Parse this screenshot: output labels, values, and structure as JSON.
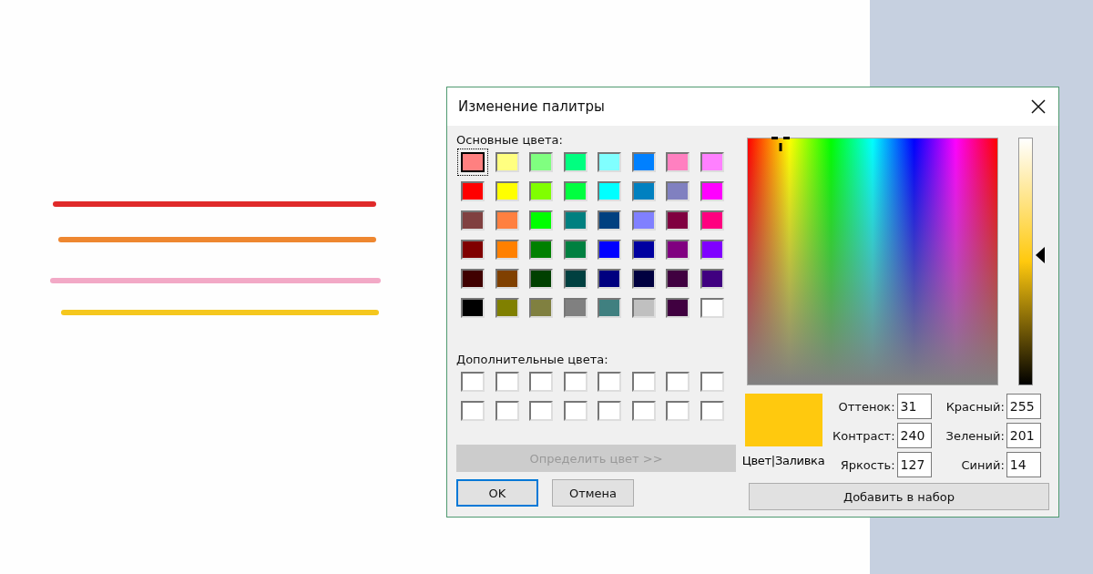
{
  "canvas": {
    "strokes": [
      {
        "color": "#e02a2a"
      },
      {
        "color": "#ee8730"
      },
      {
        "color": "#f2a9c6"
      },
      {
        "color": "#f5c71e"
      }
    ]
  },
  "dialog": {
    "title": "Изменение палитры",
    "basic_colors_label": "Основные цвета:",
    "basic_colors": [
      {
        "color": "#ff8080",
        "selected": true
      },
      {
        "color": "#ffff80",
        "selected": false
      },
      {
        "color": "#80ff80",
        "selected": false
      },
      {
        "color": "#00ff80",
        "selected": false
      },
      {
        "color": "#80ffff",
        "selected": false
      },
      {
        "color": "#0080ff",
        "selected": false
      },
      {
        "color": "#ff80c0",
        "selected": false
      },
      {
        "color": "#ff80ff",
        "selected": false
      },
      {
        "color": "#ff0000",
        "selected": false
      },
      {
        "color": "#ffff00",
        "selected": false
      },
      {
        "color": "#80ff00",
        "selected": false
      },
      {
        "color": "#00ff40",
        "selected": false
      },
      {
        "color": "#00ffff",
        "selected": false
      },
      {
        "color": "#0080c0",
        "selected": false
      },
      {
        "color": "#8080c0",
        "selected": false
      },
      {
        "color": "#ff00ff",
        "selected": false
      },
      {
        "color": "#804040",
        "selected": false
      },
      {
        "color": "#ff8040",
        "selected": false
      },
      {
        "color": "#00ff00",
        "selected": false
      },
      {
        "color": "#008080",
        "selected": false
      },
      {
        "color": "#004080",
        "selected": false
      },
      {
        "color": "#8080ff",
        "selected": false
      },
      {
        "color": "#800040",
        "selected": false
      },
      {
        "color": "#ff0080",
        "selected": false
      },
      {
        "color": "#800000",
        "selected": false
      },
      {
        "color": "#ff8000",
        "selected": false
      },
      {
        "color": "#008000",
        "selected": false
      },
      {
        "color": "#008040",
        "selected": false
      },
      {
        "color": "#0000ff",
        "selected": false
      },
      {
        "color": "#0000a0",
        "selected": false
      },
      {
        "color": "#800080",
        "selected": false
      },
      {
        "color": "#8000ff",
        "selected": false
      },
      {
        "color": "#400000",
        "selected": false
      },
      {
        "color": "#804000",
        "selected": false
      },
      {
        "color": "#004000",
        "selected": false
      },
      {
        "color": "#004040",
        "selected": false
      },
      {
        "color": "#000080",
        "selected": false
      },
      {
        "color": "#000040",
        "selected": false
      },
      {
        "color": "#400040",
        "selected": false
      },
      {
        "color": "#400080",
        "selected": false
      },
      {
        "color": "#000000",
        "selected": false
      },
      {
        "color": "#808000",
        "selected": false
      },
      {
        "color": "#808040",
        "selected": false
      },
      {
        "color": "#808080",
        "selected": false
      },
      {
        "color": "#408080",
        "selected": false
      },
      {
        "color": "#c0c0c0",
        "selected": false
      },
      {
        "color": "#400040",
        "selected": false
      },
      {
        "color": "#ffffff",
        "selected": false
      }
    ],
    "custom_colors_label": "Дополнительные цвета:",
    "custom_colors": [
      {
        "color": "#ffffff"
      },
      {
        "color": "#ffffff"
      },
      {
        "color": "#ffffff"
      },
      {
        "color": "#ffffff"
      },
      {
        "color": "#ffffff"
      },
      {
        "color": "#ffffff"
      },
      {
        "color": "#ffffff"
      },
      {
        "color": "#ffffff"
      },
      {
        "color": "#ffffff"
      },
      {
        "color": "#ffffff"
      },
      {
        "color": "#ffffff"
      },
      {
        "color": "#ffffff"
      },
      {
        "color": "#ffffff"
      },
      {
        "color": "#ffffff"
      },
      {
        "color": "#ffffff"
      },
      {
        "color": "#ffffff"
      }
    ],
    "define_button": {
      "label": "Определить цвет >>",
      "disabled": true
    },
    "buttons": [
      {
        "label": "OK",
        "default": true
      },
      {
        "label": "Отмена",
        "default": false
      }
    ],
    "luminance": {
      "level": 0.53
    },
    "preview": {
      "color": "#ffc90e",
      "caption": "Цвет|Заливка"
    },
    "fields_left": [
      {
        "label": "Оттенок:",
        "value": "31"
      },
      {
        "label": "Контраст:",
        "value": "240"
      },
      {
        "label": "Яркость:",
        "value": "127"
      }
    ],
    "fields_right": [
      {
        "label": "Красный:",
        "value": "255"
      },
      {
        "label": "Зеленый:",
        "value": "201"
      },
      {
        "label": "Синий:",
        "value": "14"
      }
    ],
    "add_button": {
      "label": "Добавить в набор"
    }
  }
}
